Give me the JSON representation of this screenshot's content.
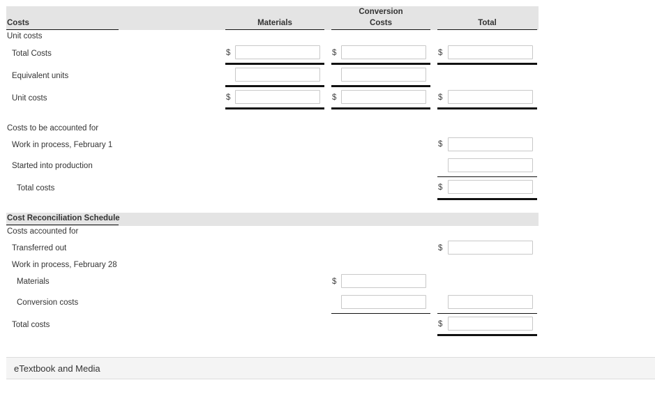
{
  "header": {
    "costs_label": "Costs",
    "columns": [
      {
        "line1": "",
        "line2": "Materials"
      },
      {
        "line1": "Conversion",
        "line2": "Costs"
      },
      {
        "line1": "",
        "line2": "Total"
      }
    ]
  },
  "currency_symbol": "$",
  "unit_costs": {
    "section_label": "Unit costs",
    "rows": [
      {
        "label": "Total Costs",
        "values": [
          "",
          "",
          ""
        ]
      },
      {
        "label": "Equivalent units",
        "values": [
          "",
          ""
        ]
      },
      {
        "label": "Unit costs",
        "values": [
          "",
          "",
          ""
        ]
      }
    ]
  },
  "costs_to_account": {
    "section_label": "Costs to be accounted for",
    "rows": [
      {
        "label": "Work in process, February 1",
        "value": ""
      },
      {
        "label": "Started into production",
        "value": ""
      },
      {
        "label": "Total costs",
        "value": ""
      }
    ]
  },
  "reconciliation": {
    "title": "Cost Reconciliation Schedule",
    "section_label": "Costs accounted for",
    "rows": [
      {
        "label": "Transferred out",
        "value": ""
      },
      {
        "label": "Work in process, February 28",
        "value": ""
      },
      {
        "label": "Materials",
        "value": ""
      },
      {
        "label": "Conversion costs",
        "value": "",
        "total_value": ""
      },
      {
        "label": "Total costs",
        "value": ""
      }
    ]
  },
  "footer": {
    "label": "eTextbook and Media"
  }
}
